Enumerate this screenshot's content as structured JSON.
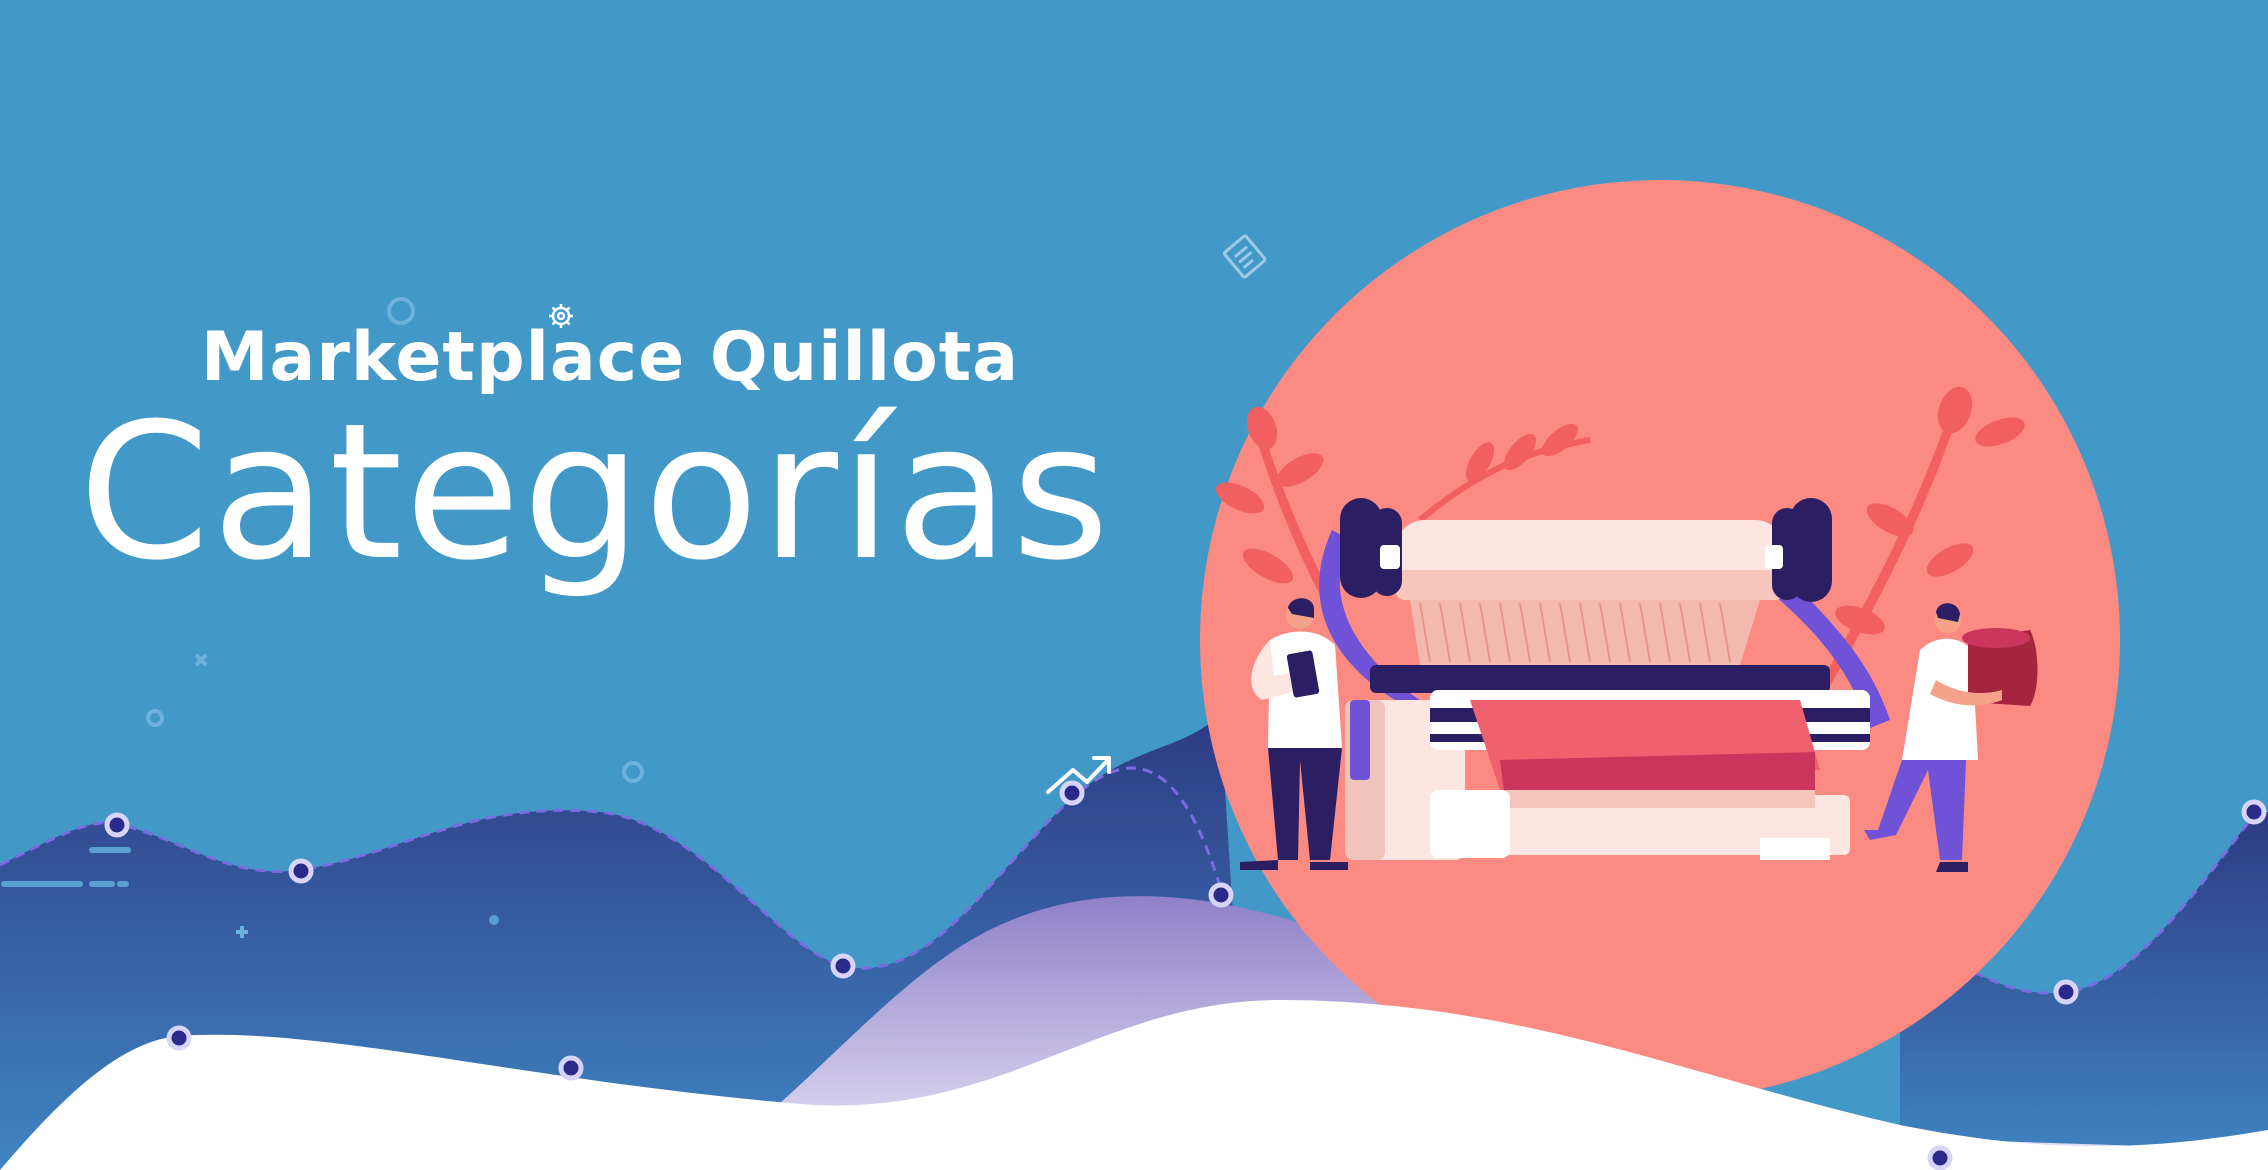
{
  "hero": {
    "subtitle": "Marketplace Quillota",
    "title": "Categorías"
  },
  "colors": {
    "background": "#4299c8",
    "wave_dark": "#2e3a86",
    "wave_light": "#3d82bf",
    "circle": "#fb8a82",
    "accent_purple": "#6f52d6",
    "navy": "#2b1e63",
    "white": "#ffffff"
  },
  "illustration": {
    "subject": "textile-loom-with-two-workers",
    "icons": [
      "gear-icon",
      "document-icon",
      "trend-arrow-icon"
    ]
  }
}
